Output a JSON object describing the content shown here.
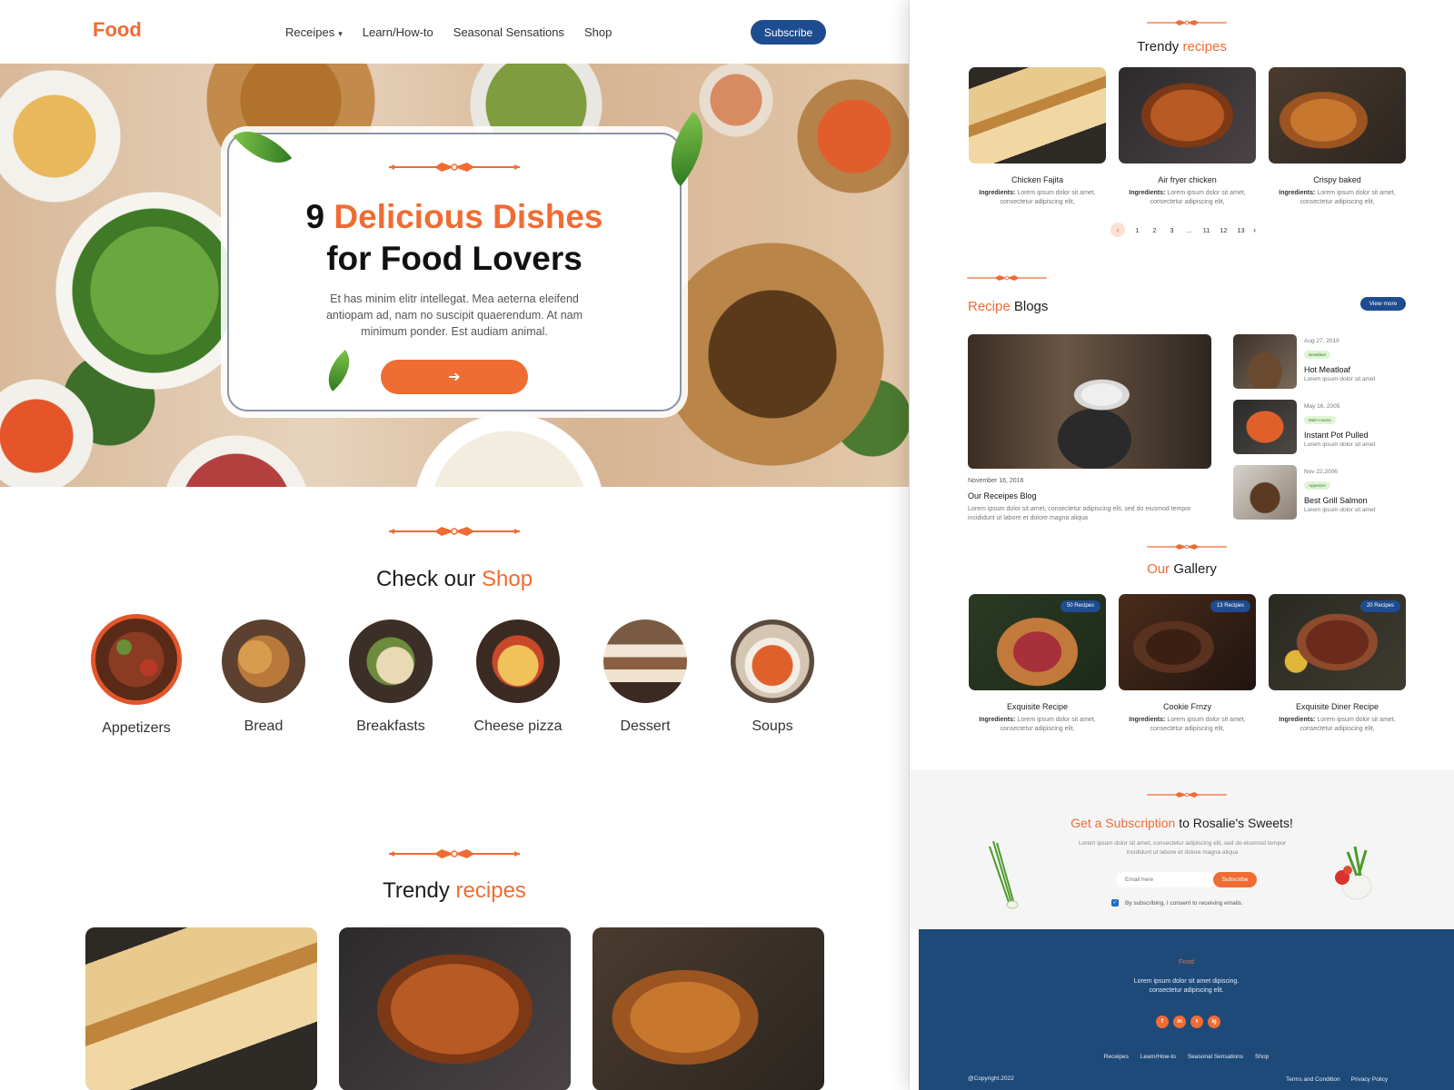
{
  "left": {
    "logo": "Food",
    "nav": [
      "Receipes",
      "Learn/How-to",
      "Seasonal Sensations",
      "Shop"
    ],
    "subscribe": "Subscribe",
    "hero": {
      "title_num": "9",
      "title_accent": "Delicious Dishes",
      "title_line2": "for Food Lovers",
      "text": "Et has minim elitr intellegat. Mea aeterna eleifend antiopam ad, nam no suscipit quaerendum. At nam minimum ponder. Est audiam animal."
    },
    "shop": {
      "title_prefix": "Check our",
      "title_accent": "Shop",
      "categories": [
        "Appetizers",
        "Bread",
        "Breakfasts",
        "Cheese pizza",
        "Dessert",
        "Soups"
      ]
    },
    "trendy": {
      "title_prefix": "Trendy",
      "title_accent": "recipes"
    }
  },
  "right": {
    "trendy": {
      "title_prefix": "Trendy",
      "title_accent": "recipes",
      "items": [
        {
          "name": "Chicken Fajita",
          "label": "Ingredients:",
          "desc": "Lorem ipsum dolor sit amet, consectetur adipiscing elit,"
        },
        {
          "name": "Air fryer chicken",
          "label": "Ingredients:",
          "desc": "Lorem ipsum dolor sit amet, consectetur adipiscing elit,"
        },
        {
          "name": "Crispy baked",
          "label": "Ingredients:",
          "desc": "Lorem ipsum dolor sit amet, consectetur adipiscing elit,"
        }
      ],
      "pages": [
        "1",
        "2",
        "3",
        "…",
        "11",
        "12",
        "13"
      ]
    },
    "blogs": {
      "title_accent": "Recipe",
      "title_suffix": "Blogs",
      "view_more": "View more",
      "main": {
        "date": "November 16, 2016",
        "title": "Our Receipes Blog",
        "desc": "Lorem ipsum dolor sit amet, consectetur adipiscing elit, sed do eiusmod tempor incididunt ut labore et dolore magna aliqua"
      },
      "side": [
        {
          "date": "Aug 27, 2019",
          "tag": "Breakfast",
          "name": "Hot Meatloaf",
          "desc": "Lorem ipsum dolor sit amet"
        },
        {
          "date": "May 16, 2005",
          "tag": "Main-course",
          "name": "Instant Pot Pulled",
          "desc": "Lorem ipsum dolor sit amet"
        },
        {
          "date": "Nov 22,2006",
          "tag": "Appetizer",
          "name": "Best Grill Salmon",
          "desc": "Lorem ipsum dolor sit amet"
        }
      ]
    },
    "gallery": {
      "title_accent": "Our",
      "title_suffix": "Gallery",
      "items": [
        {
          "badge": "50 Recipes",
          "name": "Exquisite Recipe",
          "label": "Ingredients:",
          "desc": "Lorem ipsum dolor sit amet, consectetur adipiscing elit,"
        },
        {
          "badge": "13 Recipes",
          "name": "Cookie Frnzy",
          "label": "Ingredients:",
          "desc": "Lorem ipsum dolor sit amet, consectetur adipiscing elit,"
        },
        {
          "badge": "20 Recipes",
          "name": "Exquisite Diner Recipe",
          "label": "Ingredients:",
          "desc": "Lorem ipsum dolor sit amet, consectetur adipiscing elit,"
        }
      ]
    },
    "subscription": {
      "title_accent": "Get a Subscription",
      "title_suffix": "to Rosalie's Sweets!",
      "desc": "Lorem ipsum dolor sit amet, consectetur adipiscing elit, sed do eiusmod tempor incididunt ut labore et dolore magna aliqua",
      "placeholder": "Email here",
      "button": "Subscribe",
      "consent": "By subscribing, I consent to receiving emails."
    },
    "footer": {
      "logo": "Food",
      "desc_line1": "Lorem ipsum dolor sit amet dipiscing.",
      "desc_line2": "consectetur adipiscing elit.",
      "social": [
        "f",
        "in",
        "t",
        "ig"
      ],
      "links": [
        "Receipes",
        "Learn/How-to",
        "Seasonal Sensations",
        "Shop"
      ],
      "copyright": "@Copyright.2022",
      "legal": [
        "Terms and Condition",
        "Privacy Policy"
      ]
    }
  },
  "colors": {
    "accent": "#ef6c33",
    "navy": "#1e4c90",
    "footer": "#1e4a7a"
  }
}
